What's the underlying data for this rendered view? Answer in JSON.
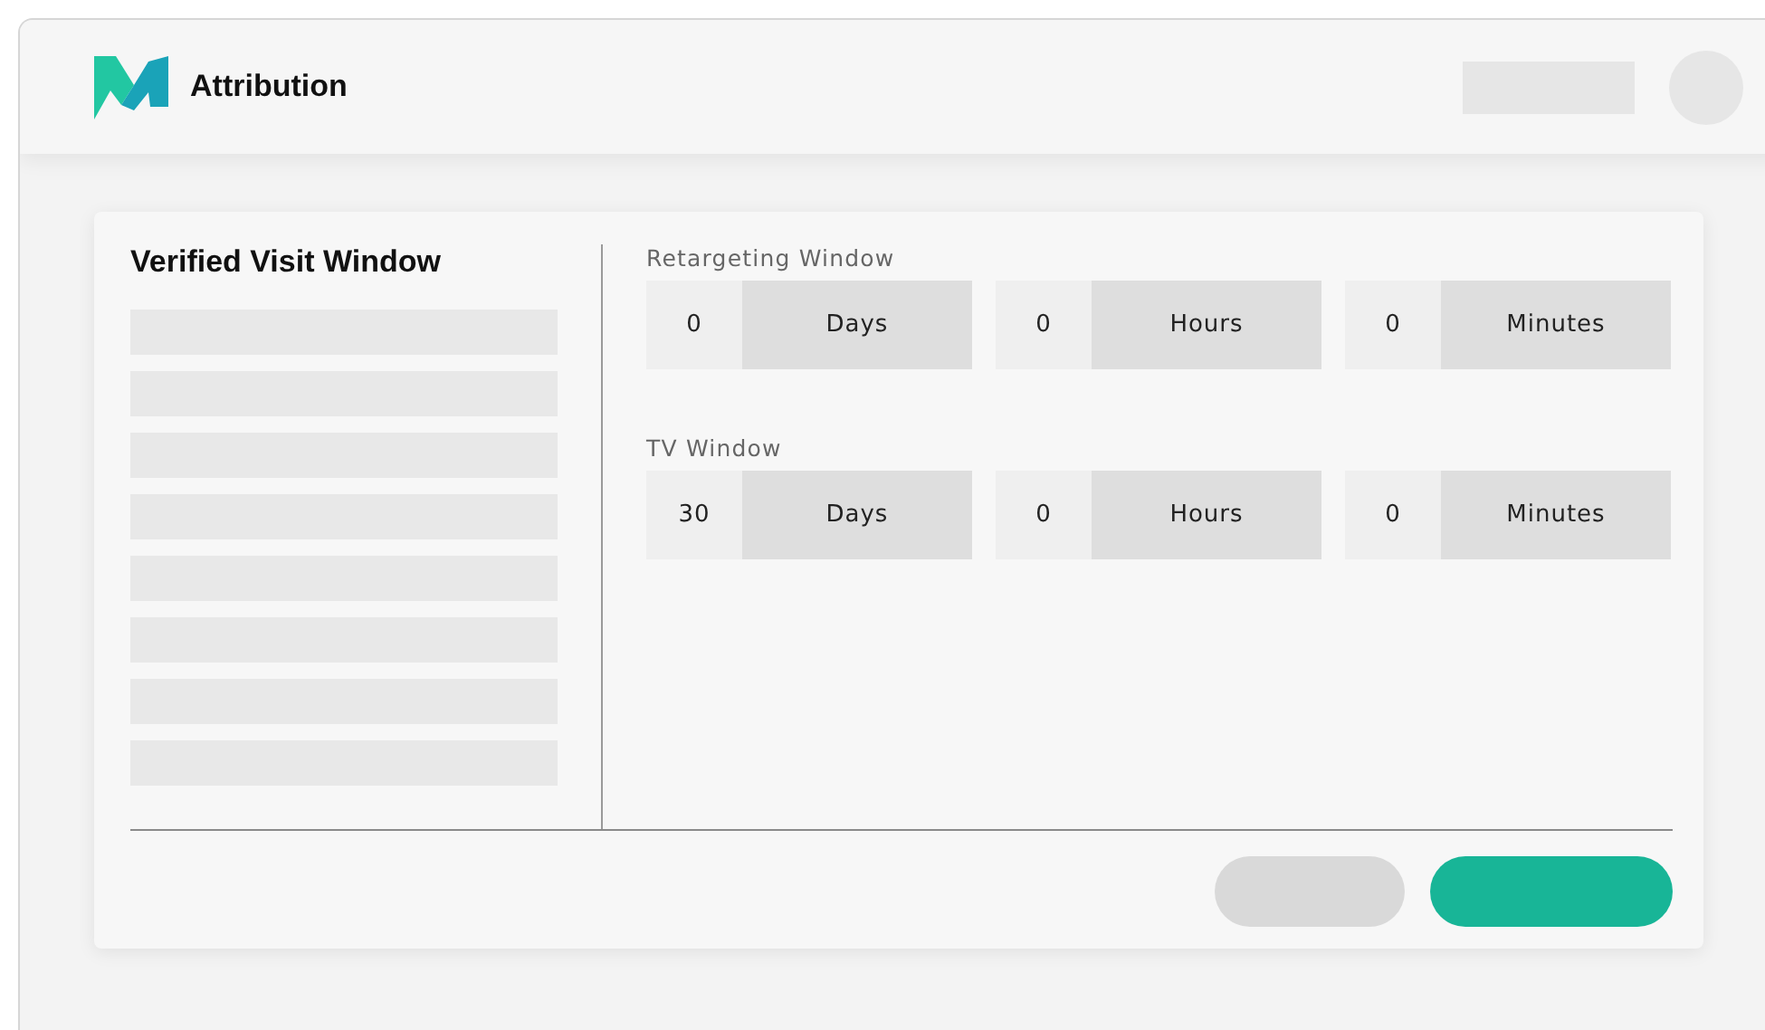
{
  "header": {
    "app_name": "Attribution"
  },
  "panel": {
    "title": "Verified Visit Window"
  },
  "windows": [
    {
      "label": "Retargeting Window",
      "fields": [
        {
          "value": "0",
          "unit": "Days"
        },
        {
          "value": "0",
          "unit": "Hours"
        },
        {
          "value": "0",
          "unit": "Minutes"
        }
      ]
    },
    {
      "label": "TV Window",
      "fields": [
        {
          "value": "30",
          "unit": "Days"
        },
        {
          "value": "0",
          "unit": "Hours"
        },
        {
          "value": "0",
          "unit": "Minutes"
        }
      ]
    }
  ],
  "buttons": [
    {
      "kind": "secondary"
    },
    {
      "kind": "primary"
    }
  ]
}
